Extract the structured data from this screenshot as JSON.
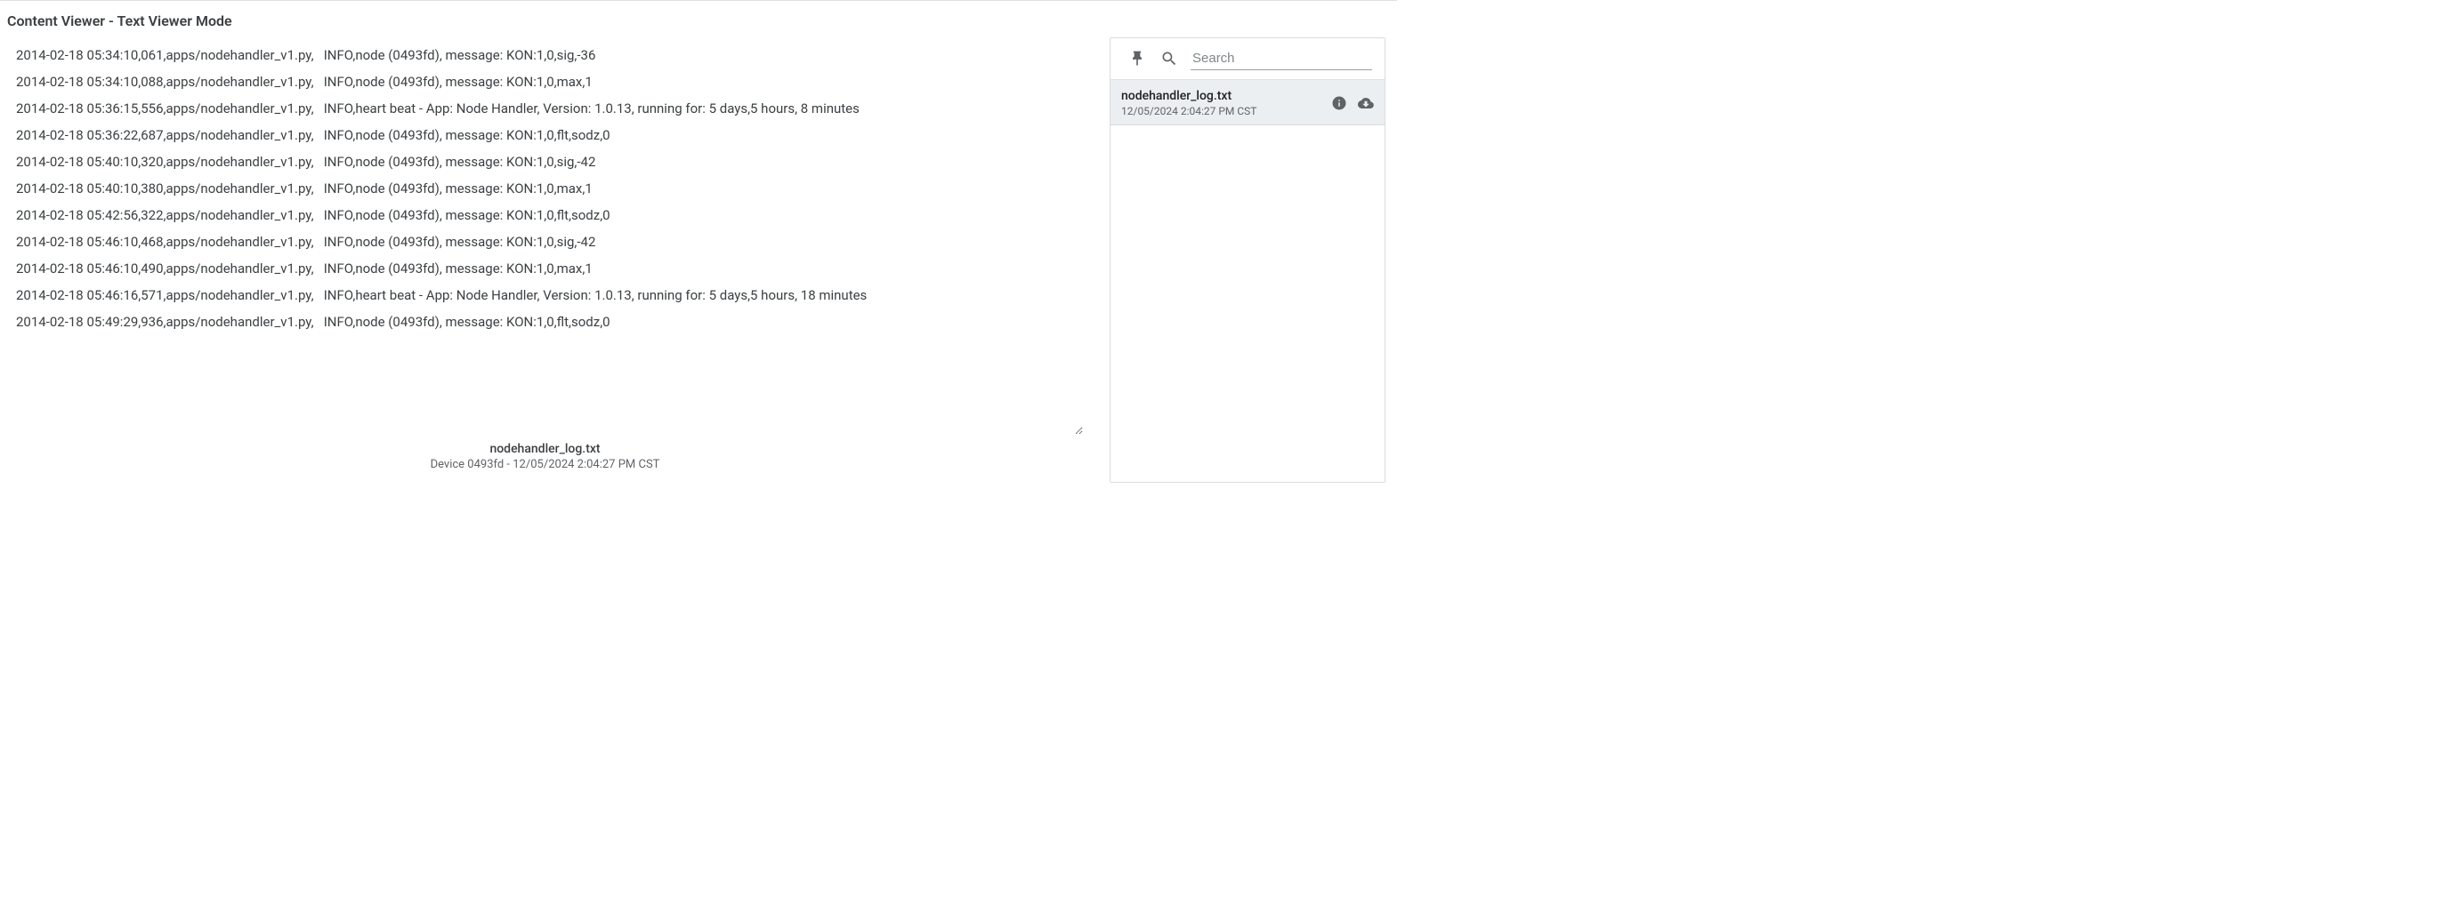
{
  "title": "Content Viewer - Text Viewer Mode",
  "log_text": "2014-02-18 05:34:10,061,apps/nodehandler_v1.py,   INFO,node (0493fd), message: KON:1,0,sig,-36\n2014-02-18 05:34:10,088,apps/nodehandler_v1.py,   INFO,node (0493fd), message: KON:1,0,max,1\n2014-02-18 05:36:15,556,apps/nodehandler_v1.py,   INFO,heart beat - App: Node Handler, Version: 1.0.13, running for: 5 days,5 hours, 8 minutes\n2014-02-18 05:36:22,687,apps/nodehandler_v1.py,   INFO,node (0493fd), message: KON:1,0,flt,sodz,0\n2014-02-18 05:40:10,320,apps/nodehandler_v1.py,   INFO,node (0493fd), message: KON:1,0,sig,-42\n2014-02-18 05:40:10,380,apps/nodehandler_v1.py,   INFO,node (0493fd), message: KON:1,0,max,1\n2014-02-18 05:42:56,322,apps/nodehandler_v1.py,   INFO,node (0493fd), message: KON:1,0,flt,sodz,0\n2014-02-18 05:46:10,468,apps/nodehandler_v1.py,   INFO,node (0493fd), message: KON:1,0,sig,-42\n2014-02-18 05:46:10,490,apps/nodehandler_v1.py,   INFO,node (0493fd), message: KON:1,0,max,1\n2014-02-18 05:46:16,571,apps/nodehandler_v1.py,   INFO,heart beat - App: Node Handler, Version: 1.0.13, running for: 5 days,5 hours, 18 minutes\n2014-02-18 05:49:29,936,apps/nodehandler_v1.py,   INFO,node (0493fd), message: KON:1,0,flt,sodz,0",
  "footer": {
    "filename": "nodehandler_log.txt",
    "meta": "Device 0493fd - 12/05/2024 2:04:27 PM CST"
  },
  "sidebar": {
    "search_placeholder": "Search",
    "file": {
      "name": "nodehandler_log.txt",
      "date": "12/05/2024 2:04:27 PM CST"
    }
  }
}
